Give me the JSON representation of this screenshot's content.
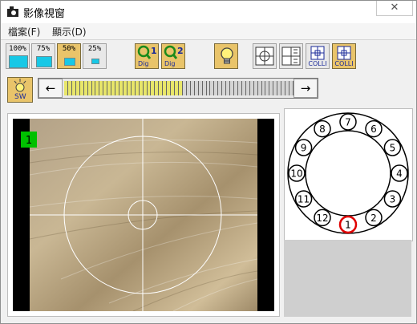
{
  "window": {
    "title": "影像視窗",
    "close_symbol": "✕"
  },
  "menu": {
    "file": "檔案(F)",
    "view": "顯示(D)"
  },
  "toolbar": {
    "zoom_buttons": [
      {
        "label": "100%",
        "level": 1.0,
        "selected": false
      },
      {
        "label": "75%",
        "level": 0.75,
        "selected": false
      },
      {
        "label": "50%",
        "level": 0.5,
        "selected": true
      },
      {
        "label": "25%",
        "level": 0.25,
        "selected": false
      }
    ],
    "dig1": {
      "number": "1",
      "sub": "Dig"
    },
    "dig2": {
      "number": "2",
      "sub": "Dig"
    },
    "light_icon": "lightbulb-icon",
    "colli1": "COLLI",
    "colli2": "COLLI"
  },
  "switch": {
    "label": "SW"
  },
  "scrollbar": {
    "left": "←",
    "right": "→",
    "filled_segments": 30,
    "total_segments": 58
  },
  "camera": {
    "badge": "1"
  },
  "position_map": {
    "positions": [
      "1",
      "2",
      "3",
      "4",
      "5",
      "6",
      "7",
      "8",
      "9",
      "10",
      "11",
      "12"
    ],
    "selected": "1"
  },
  "colors": {
    "accent_fill": "#17c8e6",
    "gold": "#e9c46a",
    "scroll_fill": "#e8e66a",
    "badge": "#00c000",
    "selected_ring": "#e00000"
  }
}
